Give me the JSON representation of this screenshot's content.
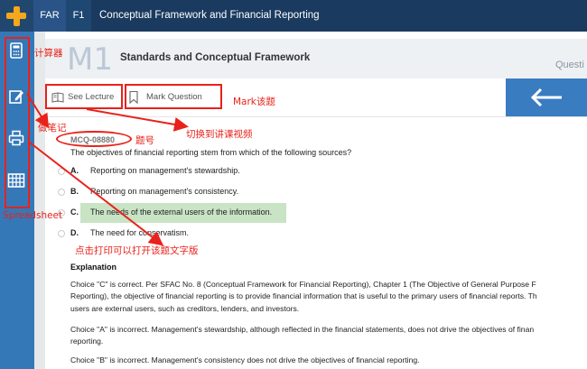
{
  "topbar": {
    "section_tab": "FAR",
    "chapter_tab": "F1",
    "breadcrumb": "Conceptual Framework and Financial Reporting"
  },
  "sidebar": {
    "items": [
      {
        "icon": "calculator-icon"
      },
      {
        "icon": "notes-pencil-icon"
      },
      {
        "icon": "printer-icon"
      },
      {
        "icon": "spreadsheet-icon"
      }
    ]
  },
  "module": {
    "number": "M1",
    "title": "Standards and Conceptual Framework",
    "question_label": "Questi"
  },
  "toolbar": {
    "see_lecture": "See Lecture",
    "mark_question": "Mark Question"
  },
  "question": {
    "id": "MCQ-08880",
    "text": "The objectives of financial reporting stem from which of the following sources?",
    "options": [
      {
        "letter": "A.",
        "text": "Reporting on management's stewardship."
      },
      {
        "letter": "B.",
        "text": "Reporting on management's consistency."
      },
      {
        "letter": "C.",
        "text": "The needs of the external users of the information."
      },
      {
        "letter": "D.",
        "text": "The need for conservatism."
      }
    ],
    "correct_option": "C"
  },
  "explanation": {
    "title": "Explanation",
    "para1_line1": "Choice \"C\" is correct. Per SFAC No. 8 (Conceptual Framework for Financial Reporting), Chapter 1 (The Objective of General Purpose F",
    "para1_line2": "Reporting), the objective of financial reporting is to provide financial information that is useful to the primary users of financial reports. Th",
    "para1_line3": "users are external users, such as creditors, lenders, and investors.",
    "para2_line1": "Choice \"A\" is incorrect. Management's stewardship, although reflected in the financial statements, does not drive the objectives of finan",
    "para2_line2": "reporting.",
    "para3_line1": "Choice \"B\" is incorrect. Management's consistency does not drive the objectives of financial reporting."
  },
  "annotations": {
    "calculator": "计算器",
    "notes": "做笔记",
    "spreadsheet": "Spreadsheet",
    "mark": "Mark该题",
    "switch_lecture": "切换到讲课视频",
    "question_number": "题号",
    "print": "点击打印可以打开该题文字版"
  },
  "colors": {
    "topbar": "#1a3a5f",
    "sidebar": "#3478b8",
    "accent_plus": "#f4a81c",
    "correct_highlight": "#c9e3c5",
    "annotation_red": "#e8221b"
  }
}
